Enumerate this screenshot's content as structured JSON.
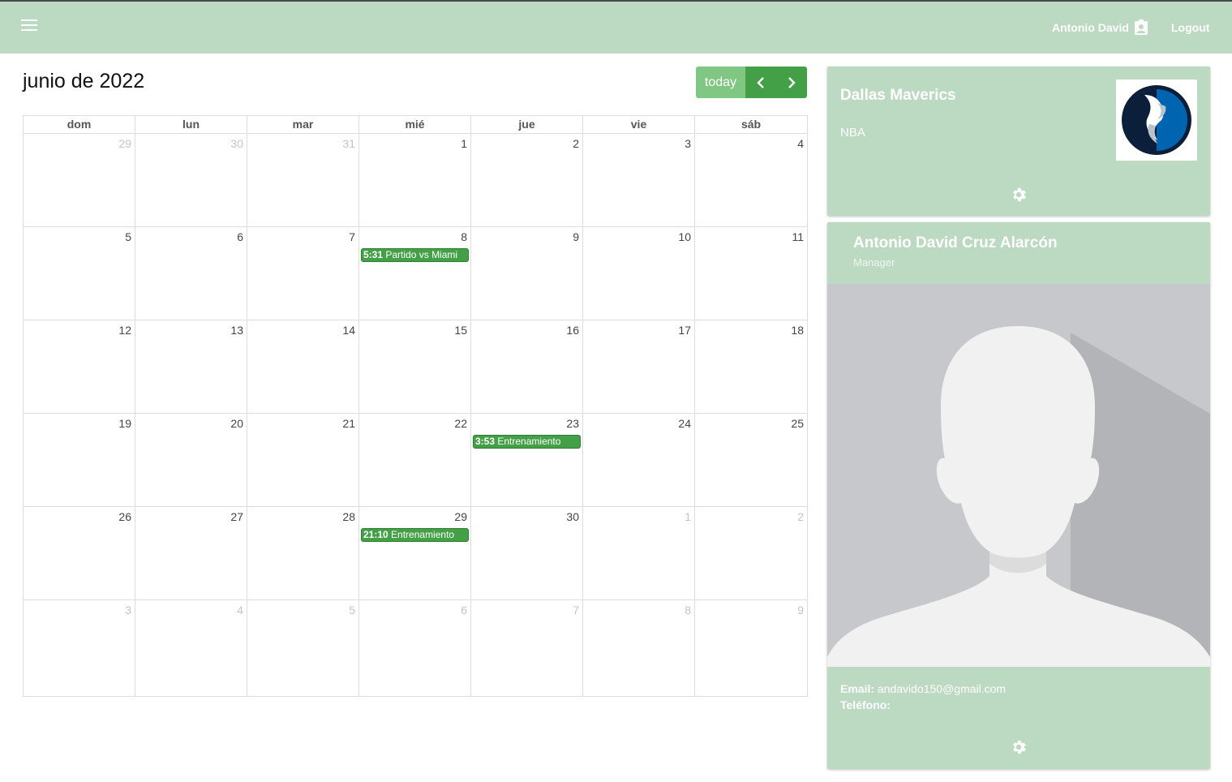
{
  "header": {
    "user_name": "Antonio David",
    "logout_label": "Logout",
    "background_color": "#bcd9c2"
  },
  "calendar": {
    "title": "junio de 2022",
    "today_label": "today",
    "weekdays": [
      "dom",
      "lun",
      "mar",
      "mié",
      "jue",
      "vie",
      "sáb"
    ],
    "weeks": [
      [
        {
          "n": "29",
          "other": true
        },
        {
          "n": "30",
          "other": true
        },
        {
          "n": "31",
          "other": true
        },
        {
          "n": "1"
        },
        {
          "n": "2"
        },
        {
          "n": "3"
        },
        {
          "n": "4"
        }
      ],
      [
        {
          "n": "5"
        },
        {
          "n": "6"
        },
        {
          "n": "7"
        },
        {
          "n": "8",
          "event": {
            "time": "5:31",
            "title": "Partido vs Miami"
          }
        },
        {
          "n": "9"
        },
        {
          "n": "10"
        },
        {
          "n": "11"
        }
      ],
      [
        {
          "n": "12"
        },
        {
          "n": "13"
        },
        {
          "n": "14"
        },
        {
          "n": "15"
        },
        {
          "n": "16"
        },
        {
          "n": "17"
        },
        {
          "n": "18"
        }
      ],
      [
        {
          "n": "19"
        },
        {
          "n": "20"
        },
        {
          "n": "21"
        },
        {
          "n": "22"
        },
        {
          "n": "23",
          "event": {
            "time": "3:53",
            "title": "Entrenamiento"
          }
        },
        {
          "n": "24"
        },
        {
          "n": "25"
        }
      ],
      [
        {
          "n": "26"
        },
        {
          "n": "27"
        },
        {
          "n": "28"
        },
        {
          "n": "29",
          "event": {
            "time": "21:10",
            "title": "Entrenamiento"
          }
        },
        {
          "n": "30"
        },
        {
          "n": "1",
          "other": true
        },
        {
          "n": "2",
          "other": true
        }
      ],
      [
        {
          "n": "3",
          "other": true
        },
        {
          "n": "4",
          "other": true
        },
        {
          "n": "5",
          "other": true
        },
        {
          "n": "6",
          "other": true
        },
        {
          "n": "7",
          "other": true
        },
        {
          "n": "8",
          "other": true
        },
        {
          "n": "9",
          "other": true
        }
      ]
    ],
    "event_color": "#43a047"
  },
  "team": {
    "name": "Dallas Maverics",
    "league": "NBA",
    "logo_icon": "dallas-mavericks-logo"
  },
  "profile": {
    "name": "Antonio David Cruz Alarcón",
    "role": "Manager",
    "email_label": "Email:",
    "email": "andavido150@gmail.com",
    "phone_label": "Teléfono:",
    "phone": ""
  }
}
